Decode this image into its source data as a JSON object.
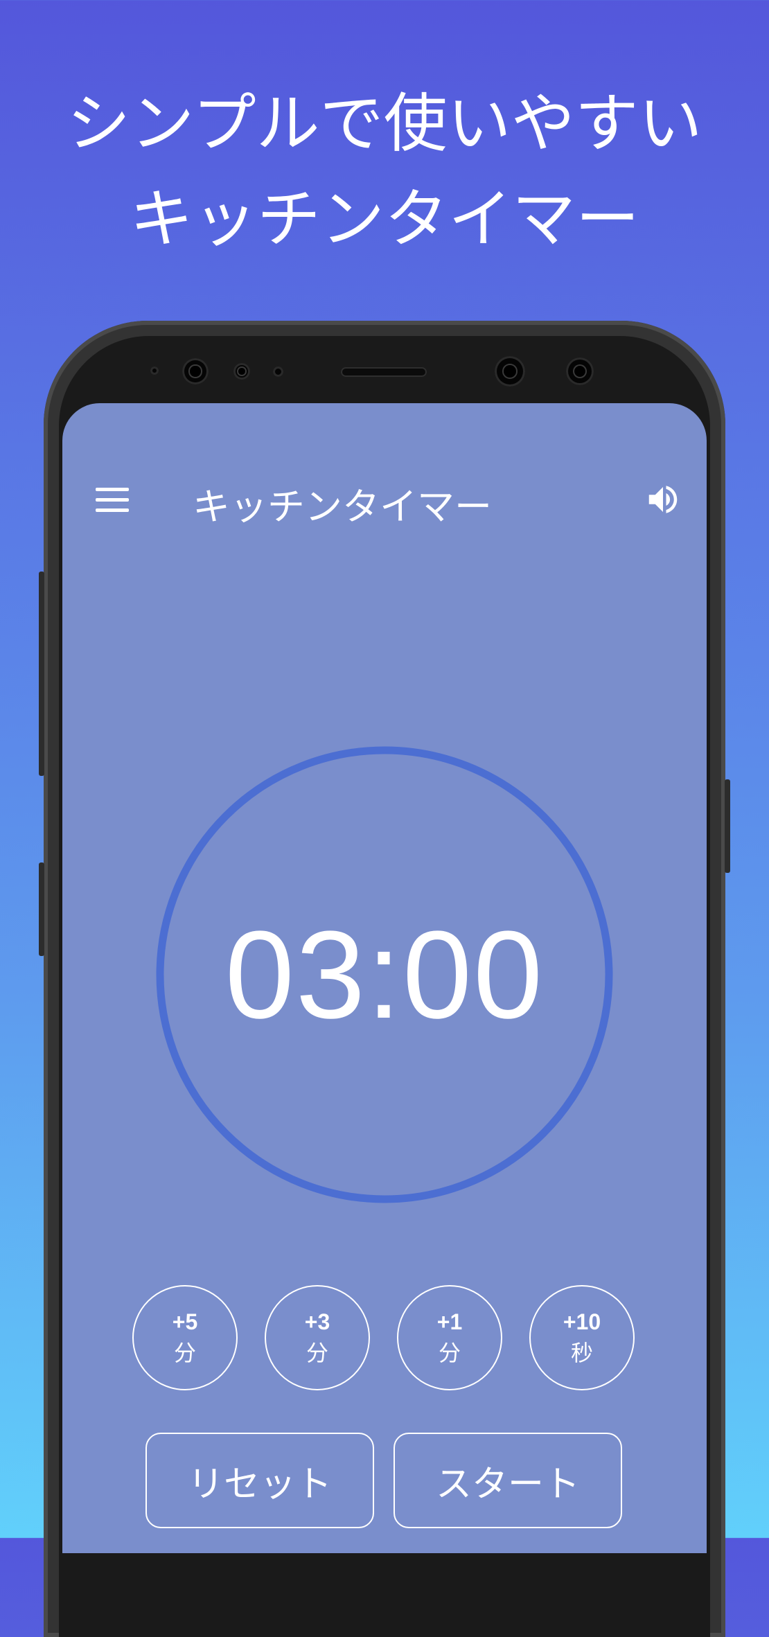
{
  "headline": {
    "line1": "シンプルで使いやすい",
    "line2": "キッチンタイマー"
  },
  "app": {
    "title": "キッチンタイマー",
    "menu_icon": "hamburger-menu-icon",
    "volume_icon": "speaker-volume-icon"
  },
  "timer": {
    "display": "03:00",
    "ring_color": "#4C6ED2"
  },
  "quick_add": [
    {
      "amount": "+5",
      "unit": "分"
    },
    {
      "amount": "+3",
      "unit": "分"
    },
    {
      "amount": "+1",
      "unit": "分"
    },
    {
      "amount": "+10",
      "unit": "秒"
    }
  ],
  "actions": {
    "reset": "リセット",
    "start": "スタート"
  },
  "colors": {
    "bg_top": "#5457DB",
    "bg_bottom": "#61D0FB",
    "screen_bg": "#7A8ECC",
    "text": "#FFFFFF"
  }
}
